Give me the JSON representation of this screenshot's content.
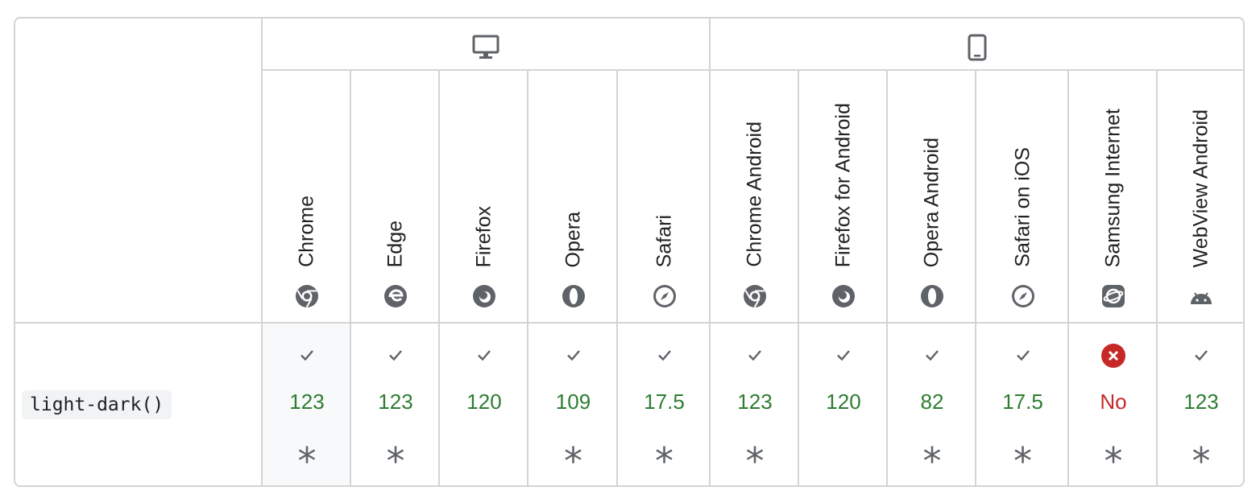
{
  "groups": [
    {
      "name": "desktop",
      "icon": "monitor-icon"
    },
    {
      "name": "mobile",
      "icon": "phone-icon"
    }
  ],
  "browsers": [
    {
      "label": "Chrome",
      "icon": "chrome-icon",
      "version": "123",
      "supported": true,
      "note": true
    },
    {
      "label": "Edge",
      "icon": "edge-icon",
      "version": "123",
      "supported": true,
      "note": true
    },
    {
      "label": "Firefox",
      "icon": "firefox-icon",
      "version": "120",
      "supported": true,
      "note": false
    },
    {
      "label": "Opera",
      "icon": "opera-icon",
      "version": "109",
      "supported": true,
      "note": true
    },
    {
      "label": "Safari",
      "icon": "safari-icon",
      "version": "17.5",
      "supported": true,
      "note": true
    },
    {
      "label": "Chrome Android",
      "icon": "chrome-icon",
      "version": "123",
      "supported": true,
      "note": true
    },
    {
      "label": "Firefox for Android",
      "icon": "firefox-icon",
      "version": "120",
      "supported": true,
      "note": false
    },
    {
      "label": "Opera Android",
      "icon": "opera-icon",
      "version": "82",
      "supported": true,
      "note": true
    },
    {
      "label": "Safari on iOS",
      "icon": "safari-icon",
      "version": "17.5",
      "supported": true,
      "note": true
    },
    {
      "label": "Samsung Internet",
      "icon": "samsung-internet-icon",
      "version": "No",
      "supported": false,
      "note": true
    },
    {
      "label": "WebView Android",
      "icon": "android-icon",
      "version": "123",
      "supported": true,
      "note": true
    }
  ],
  "feature": {
    "name": "light-dark()"
  },
  "note_symbol": "*",
  "colors": {
    "supported": "#2e7d32",
    "unsupported": "#c62828",
    "border": "#d4d4d4"
  }
}
